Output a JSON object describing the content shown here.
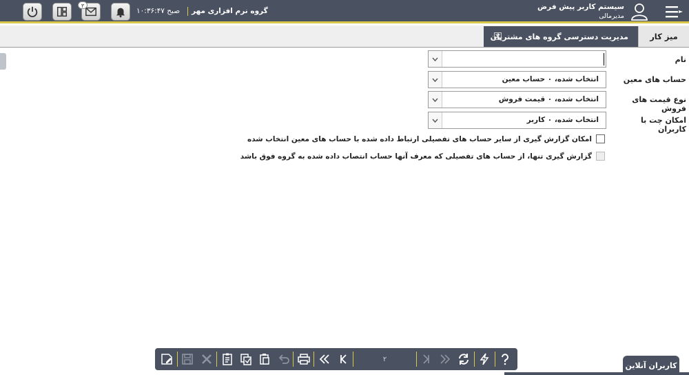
{
  "header": {
    "system_title": "سیستم کاربر پیش فرض",
    "user_role": "مدیرمالی",
    "company": "گروه نرم افزاری مهر",
    "time": "۱۰:۳۶:۴۷ صبح",
    "mail_badge": "۳"
  },
  "tabs": {
    "home_label": "میز کار",
    "active_label": "مدیریت دسترسی گروه های مشتریان"
  },
  "form": {
    "name_label": "نام",
    "name_value": "",
    "accounts_label": "حساب های معین",
    "accounts_value": "انتخاب شده، ۰ حساب معین",
    "price_types_label": "نوع قیمت های فروش",
    "price_types_value": "انتخاب شده، ۰ قیمت فروش",
    "chat_label": "امکان چت با کاربران",
    "chat_value": "انتخاب شده، ۰ کاربر",
    "check1_label": "امکان گزارش گیری از سایر حساب های تفصیلی ارتباط داده شده با حساب های معین انتخاب شده",
    "check2_label": "گزارش گیری تنها، از حساب های تفصیلی که معرف آنها حساب انتصاب داده شده به گروه فوق باشد"
  },
  "toolbar": {
    "page_number": "۲"
  },
  "online_users_label": "کاربران آنلاین"
}
